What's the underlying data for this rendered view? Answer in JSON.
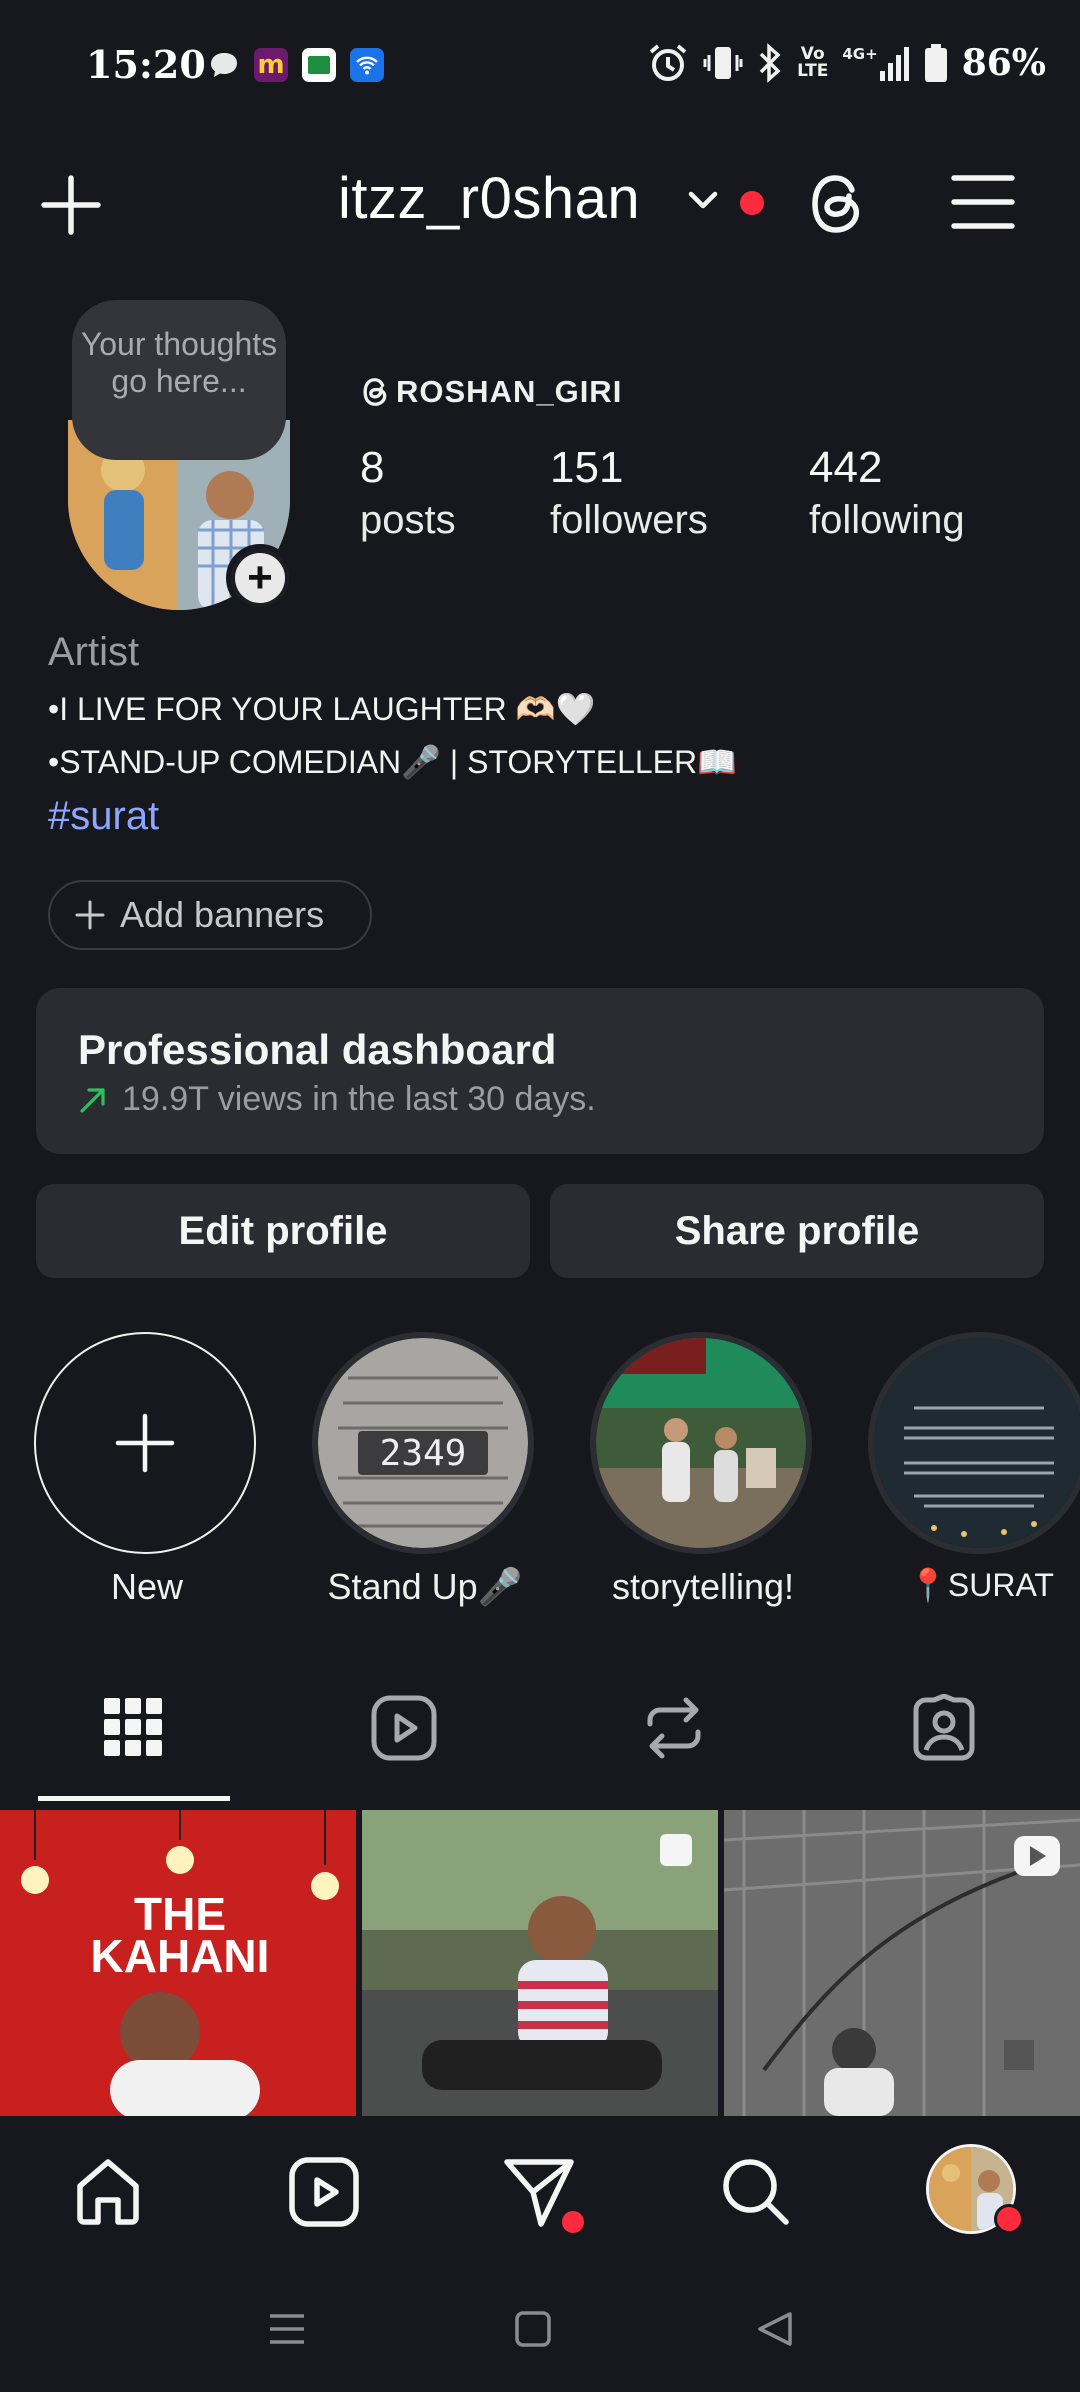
{
  "status_bar": {
    "time": "15:20",
    "battery": "86%",
    "network": "4G+",
    "volte": "Vo LTE",
    "icons_left": [
      "chat-bubble-icon",
      "m-app-icon",
      "classroom-app-icon",
      "wifi-app-icon"
    ],
    "icons_right": [
      "alarm-icon",
      "vibrate-icon",
      "bluetooth-icon",
      "volte-icon",
      "signal-icon",
      "battery-icon"
    ]
  },
  "header": {
    "username": "itzz_r0shan"
  },
  "profile": {
    "thought_bubble": "Your thoughts go here...",
    "threads_handle": "ROSHAN_GIRI",
    "stats": [
      {
        "count": "8",
        "label": "posts"
      },
      {
        "count": "151",
        "label": "followers"
      },
      {
        "count": "442",
        "label": "following"
      }
    ],
    "category": "Artist",
    "bio_line1": "•I LIVE FOR YOUR LAUGHTER 🫶🏻🤍",
    "bio_line2": "•STAND-UP COMEDIAN🎤 | STORYTELLER📖",
    "hashtag": "#surat",
    "add_banners": "Add banners"
  },
  "dashboard": {
    "title": "Professional dashboard",
    "subtitle": "19.9T views in the last 30 days."
  },
  "buttons": {
    "edit": "Edit profile",
    "share": "Share profile"
  },
  "highlights": [
    {
      "label": "New"
    },
    {
      "label": "Stand Up🎤"
    },
    {
      "label": "storytelling!"
    },
    {
      "label": "📍SURAT"
    }
  ],
  "highlight_texts": {
    "counter": "2349"
  },
  "grid": {
    "post1_text_line1": "THE",
    "post1_text_line2": "KAHANI"
  },
  "colors": {
    "background": "#17181d",
    "card": "#2b2c31",
    "notification_dot": "#ff2a3d",
    "hashtag": "#8da6ff",
    "trend_arrow": "#2dbe60"
  }
}
